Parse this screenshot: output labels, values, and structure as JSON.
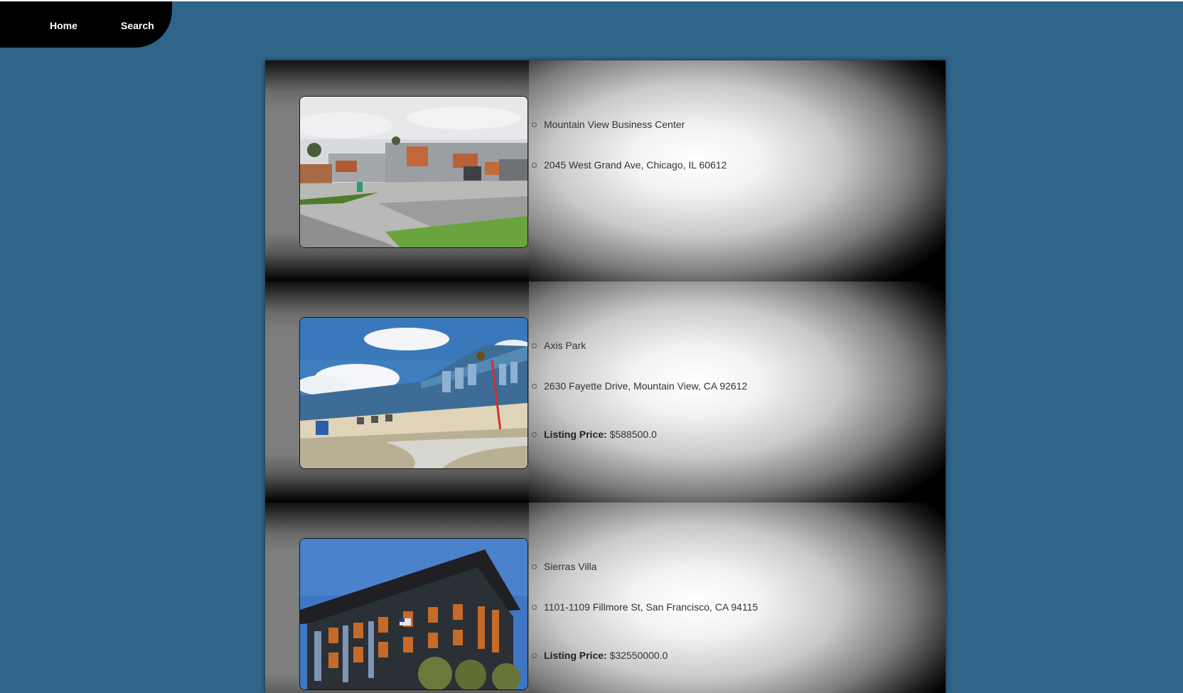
{
  "nav": {
    "home_label": "Home",
    "search_label": "Search"
  },
  "listings": [
    {
      "name": "Mountain View Business Center",
      "address": "2045 West Grand Ave, Chicago, IL 60612"
    },
    {
      "name": "Axis Park",
      "address": "2630 Fayette Drive, Mountain View, CA 92612",
      "price_label": "Listing Price:",
      "price_value": "$588500.0"
    },
    {
      "name": "Sierras Villa",
      "address": "1101-1109 Fillmore St, San Francisco, CA 94115",
      "price_label": "Listing Price:",
      "price_value": "$32550000.0"
    }
  ],
  "colors": {
    "page_background": "#2e6589",
    "nav_background": "#000000",
    "nav_text": "#ffffff"
  }
}
